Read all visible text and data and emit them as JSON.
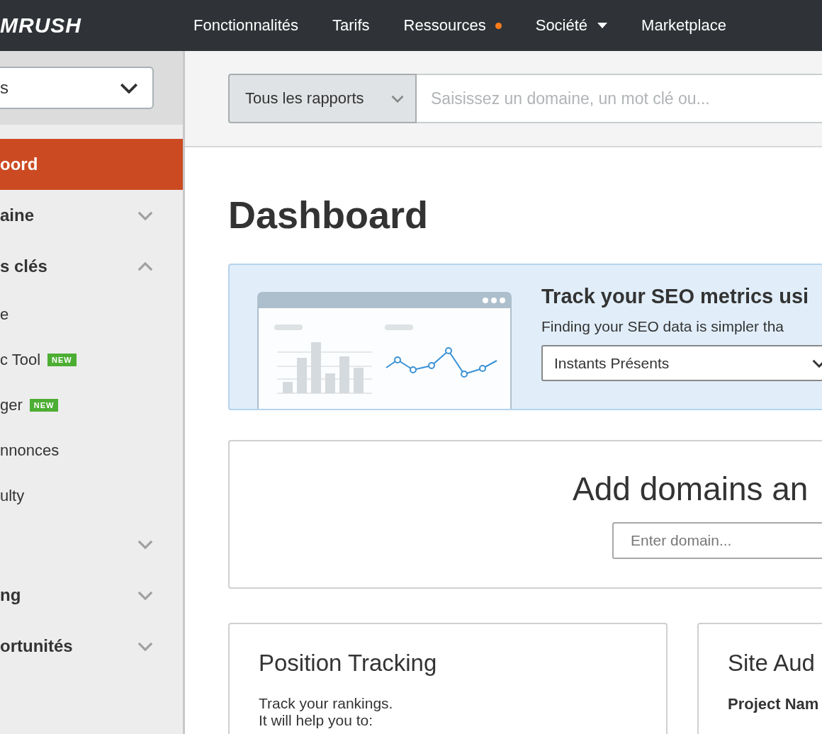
{
  "header": {
    "logo": "MRUSH",
    "nav": [
      {
        "label": "Fonctionnalités",
        "dot": false,
        "caret": false
      },
      {
        "label": "Tarifs",
        "dot": false,
        "caret": false
      },
      {
        "label": "Ressources",
        "dot": true,
        "caret": false
      },
      {
        "label": "Société",
        "dot": false,
        "caret": true
      },
      {
        "label": "Marketplace",
        "dot": false,
        "caret": false
      }
    ]
  },
  "sidebar": {
    "dropdown": {
      "value": "s"
    },
    "items": [
      {
        "kind": "header",
        "label": "oord",
        "selected": true
      },
      {
        "kind": "header",
        "label": "aine",
        "selected": false,
        "expanded": false
      },
      {
        "kind": "header",
        "label": "s clés",
        "selected": false,
        "expanded": true
      },
      {
        "kind": "sub",
        "label": "e",
        "selected": false
      },
      {
        "kind": "sub",
        "label": "c Tool",
        "selected": false,
        "badge": "NEW"
      },
      {
        "kind": "sub",
        "label": "ger",
        "selected": false,
        "badge": "NEW"
      },
      {
        "kind": "sub",
        "label": "nnonces",
        "selected": false
      },
      {
        "kind": "sub",
        "label": "ulty",
        "selected": false
      },
      {
        "kind": "header",
        "selected": false,
        "expanded": false
      },
      {
        "kind": "header",
        "label": "ng",
        "selected": false,
        "expanded": false
      },
      {
        "kind": "header",
        "label": "ortunités",
        "selected": false,
        "expanded": false
      }
    ]
  },
  "search": {
    "report_select": "Tous les rapports",
    "placeholder": "Saisissez un domaine, un mot clé ou..."
  },
  "page_title": "Dashboard",
  "banner": {
    "title": "Track your SEO metrics usi",
    "text": "Finding your SEO data is simpler tha",
    "select": "Instants Présents"
  },
  "add_domains": {
    "title": "Add domains an",
    "placeholder": "Enter domain..."
  },
  "cards": [
    {
      "title": "Position Tracking",
      "lines": [
        "Track your rankings.",
        "It will help you to:"
      ]
    },
    {
      "title": "Site Aud",
      "subtitle": "Project Nam"
    }
  ]
}
